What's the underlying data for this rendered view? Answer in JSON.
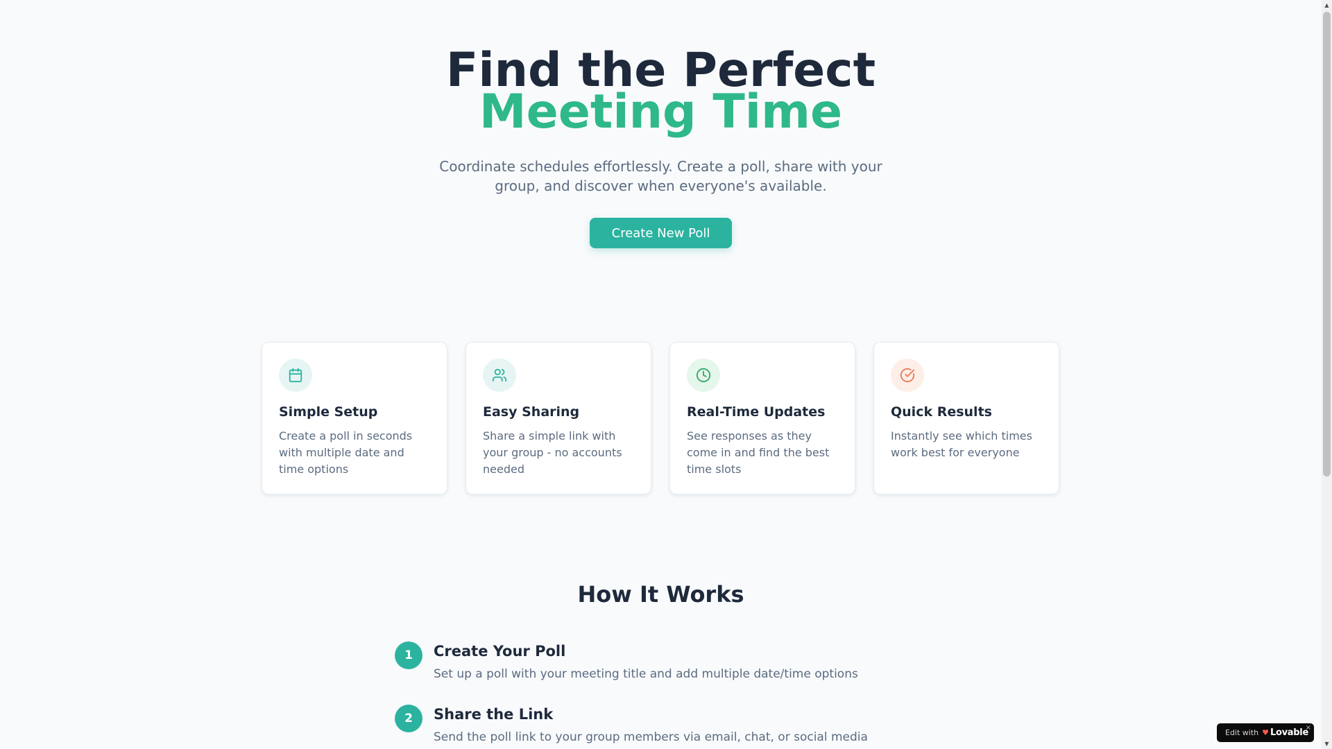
{
  "hero": {
    "title_line1": "Find the Perfect",
    "title_line2": "Meeting Time",
    "subtitle": "Coordinate schedules effortlessly. Create a poll, share with your group, and discover when everyone's available.",
    "cta_label": "Create New Poll"
  },
  "features": [
    {
      "icon": "calendar-icon",
      "title": "Simple Setup",
      "desc": "Create a poll in seconds with multiple date and time options"
    },
    {
      "icon": "users-icon",
      "title": "Easy Sharing",
      "desc": "Share a simple link with your group - no accounts needed"
    },
    {
      "icon": "clock-icon",
      "title": "Real-Time Updates",
      "desc": "See responses as they come in and find the best time slots"
    },
    {
      "icon": "check-circle-icon",
      "title": "Quick Results",
      "desc": "Instantly see which times work best for everyone"
    }
  ],
  "how": {
    "title": "How It Works",
    "steps": [
      {
        "num": "1",
        "title": "Create Your Poll",
        "desc": "Set up a poll with your meeting title and add multiple date/time options"
      },
      {
        "num": "2",
        "title": "Share the Link",
        "desc": "Send the poll link to your group members via email, chat, or social media"
      }
    ]
  },
  "badge": {
    "edit_label": "Edit with",
    "brand": "Lovable",
    "close": "×"
  },
  "colors": {
    "accent_green": "#2fb889",
    "primary_teal": "#2bb3a0",
    "heading": "#1e293b",
    "muted": "#5b6b7f"
  }
}
